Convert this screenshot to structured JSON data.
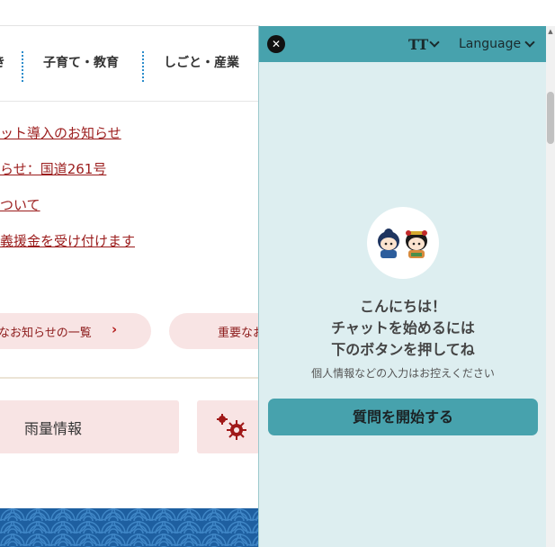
{
  "nav": {
    "partial_item": "き",
    "items": [
      "子育て・教育",
      "しごと・産業"
    ]
  },
  "news": {
    "links": [
      "ット導入のお知らせ",
      "らせ：国道261号",
      "ついて",
      "義援金を受け付けます"
    ]
  },
  "pills": {
    "left_label": "なお知らせの一覧",
    "right_label": "重要なお"
  },
  "cards": {
    "rain_label": "雨量情報"
  },
  "chat": {
    "font_size_label": "TT",
    "language_label": "Language",
    "greeting_lines": [
      "こんにちは！",
      "チャットを始めるには",
      "下のボタンを押してね"
    ],
    "note": "個人情報などの入力はお控えください",
    "start_button": "質問を開始する"
  },
  "colors": {
    "chat_header": "#47a2ad",
    "chat_body": "#ddeef0",
    "link": "#9b1c1c",
    "pill": "#f8e4e4"
  }
}
